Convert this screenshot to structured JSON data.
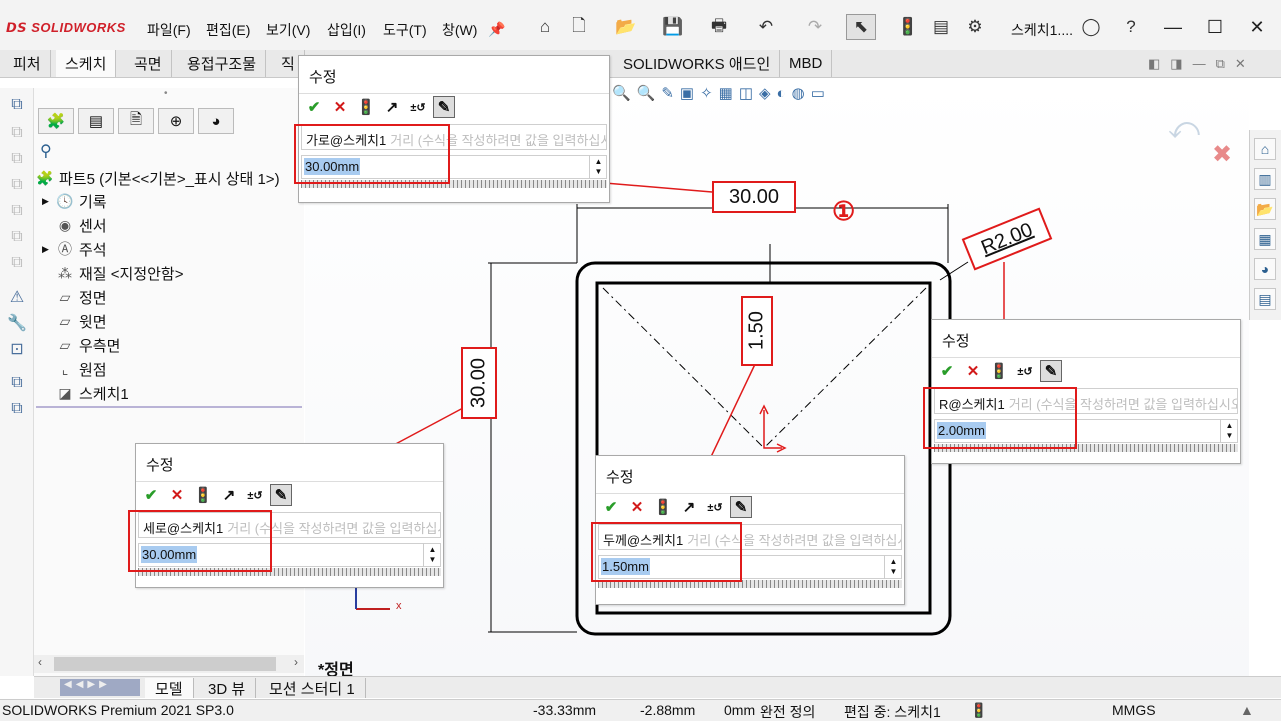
{
  "app": {
    "logo": "SOLIDWORKS",
    "doc_title": "스케치1...."
  },
  "menu": [
    "파일(F)",
    "편집(E)",
    "보기(V)",
    "삽입(I)",
    "도구(T)",
    "창(W)"
  ],
  "command_tabs": [
    "피처",
    "스케치",
    "곡면",
    "용접구조물",
    "직",
    "SOLIDWORKS 애드인",
    "MBD"
  ],
  "tree": {
    "root": "파트5  (기본<<기본>_표시 상태 1>)",
    "items": [
      "기록",
      "센서",
      "주석",
      "재질 <지정안함>",
      "정면",
      "윗면",
      "우측면",
      "원점",
      "스케치1"
    ]
  },
  "view_label": "*정면",
  "bottom_tabs": [
    "모델",
    "3D 뷰",
    "모션 스터디 1"
  ],
  "status": {
    "product": "SOLIDWORKS Premium 2021 SP3.0",
    "x": "-33.33mm",
    "y": "-2.88mm",
    "z": "0mm",
    "definition": "완전 정의",
    "editing": "편집 중: 스케치1",
    "units": "MMGS"
  },
  "dialog_common": {
    "title": "수정",
    "hint": "거리 (수식을 작성하려면 값을 입력하십시오)"
  },
  "dialogs": {
    "horizontal": {
      "name": "가로@스케치1",
      "value": "30.00mm"
    },
    "vertical": {
      "name": "세로@스케치1",
      "value": "30.00mm"
    },
    "thickness": {
      "name": "두께@스케치1",
      "value": "1.50mm"
    },
    "radius": {
      "name": "R@스케치1",
      "value": "2.00mm"
    }
  },
  "dimensions": {
    "top": "30.00",
    "left": "30.00",
    "thickness": "1.50",
    "radius": "R2.00",
    "marker": "①"
  },
  "axis": {
    "x": "x"
  },
  "colors": {
    "accent_red": "#e01b1b",
    "selection": "#a8cbf0",
    "logo_red": "#d0202a"
  }
}
